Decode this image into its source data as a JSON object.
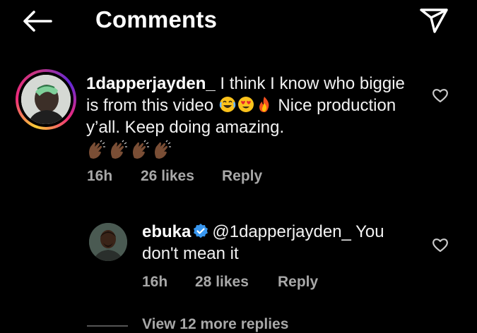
{
  "header": {
    "title": "Comments",
    "back_icon": "arrow-left-icon",
    "share_icon": "paper-plane-icon"
  },
  "comments": [
    {
      "username": "1dapperjayden_",
      "text_part1": "I think I know who biggie is from this video",
      "emojis": [
        "face-with-tears-of-joy",
        "smiling-face-with-heart-eyes",
        "fire"
      ],
      "text_part2": "Nice production y’all. Keep doing amazing.",
      "claps": [
        "clapping-hands",
        "clapping-hands",
        "clapping-hands",
        "clapping-hands"
      ],
      "time": "16h",
      "likes": "26 likes",
      "reply_label": "Reply",
      "has_story_ring": true
    },
    {
      "username": "ebuka",
      "verified": true,
      "mention": "@1dapperjayden_",
      "text": "You don't mean it",
      "time": "16h",
      "likes": "28 likes",
      "reply_label": "Reply"
    }
  ],
  "view_more": "View 12 more replies",
  "colors": {
    "background": "#000000",
    "text": "#ffffff",
    "meta": "#a8a8a8",
    "verified_blue": "#3897f0"
  }
}
